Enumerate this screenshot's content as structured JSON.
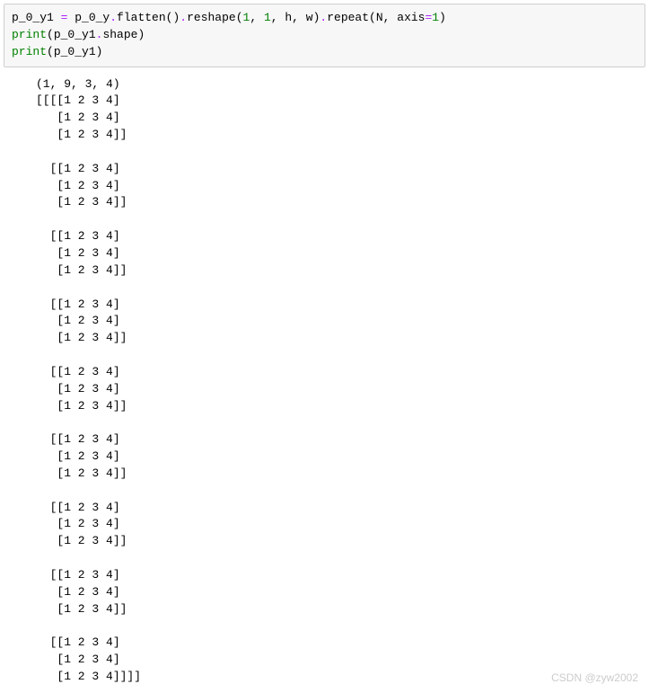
{
  "code": {
    "l1_a": "p_0_y1 ",
    "l1_eq": "=",
    "l1_b": " p_0_y",
    "l1_dot1": ".",
    "l1_flatten": "flatten",
    "l1_p_open1": "(",
    "l1_p_close1": ")",
    "l1_dot2": ".",
    "l1_reshape": "reshape",
    "l1_p_open2": "(",
    "l1_n1": "1",
    "l1_c1": ", ",
    "l1_n2": "1",
    "l1_c2": ", ",
    "l1_h": "h",
    "l1_c3": ", ",
    "l1_w": "w",
    "l1_p_close2": ")",
    "l1_dot3": ".",
    "l1_repeat": "repeat",
    "l1_p_open3": "(",
    "l1_Nvar": "N",
    "l1_c4": ", ",
    "l1_axis": "axis",
    "l1_eq2": "=",
    "l1_n3": "1",
    "l1_p_close3": ")",
    "l2_print": "print",
    "l2_open": "(",
    "l2_arg": "p_0_y1",
    "l2_dot": ".",
    "l2_shape": "shape",
    "l2_close": ")",
    "l3_print": "print",
    "l3_open": "(",
    "l3_arg": "p_0_y1",
    "l3_close": ")"
  },
  "output": {
    "text": "(1, 9, 3, 4)\n[[[[1 2 3 4]\n   [1 2 3 4]\n   [1 2 3 4]]\n\n  [[1 2 3 4]\n   [1 2 3 4]\n   [1 2 3 4]]\n\n  [[1 2 3 4]\n   [1 2 3 4]\n   [1 2 3 4]]\n\n  [[1 2 3 4]\n   [1 2 3 4]\n   [1 2 3 4]]\n\n  [[1 2 3 4]\n   [1 2 3 4]\n   [1 2 3 4]]\n\n  [[1 2 3 4]\n   [1 2 3 4]\n   [1 2 3 4]]\n\n  [[1 2 3 4]\n   [1 2 3 4]\n   [1 2 3 4]]\n\n  [[1 2 3 4]\n   [1 2 3 4]\n   [1 2 3 4]]\n\n  [[1 2 3 4]\n   [1 2 3 4]\n   [1 2 3 4]]]]"
  },
  "watermark": "CSDN @zyw2002"
}
